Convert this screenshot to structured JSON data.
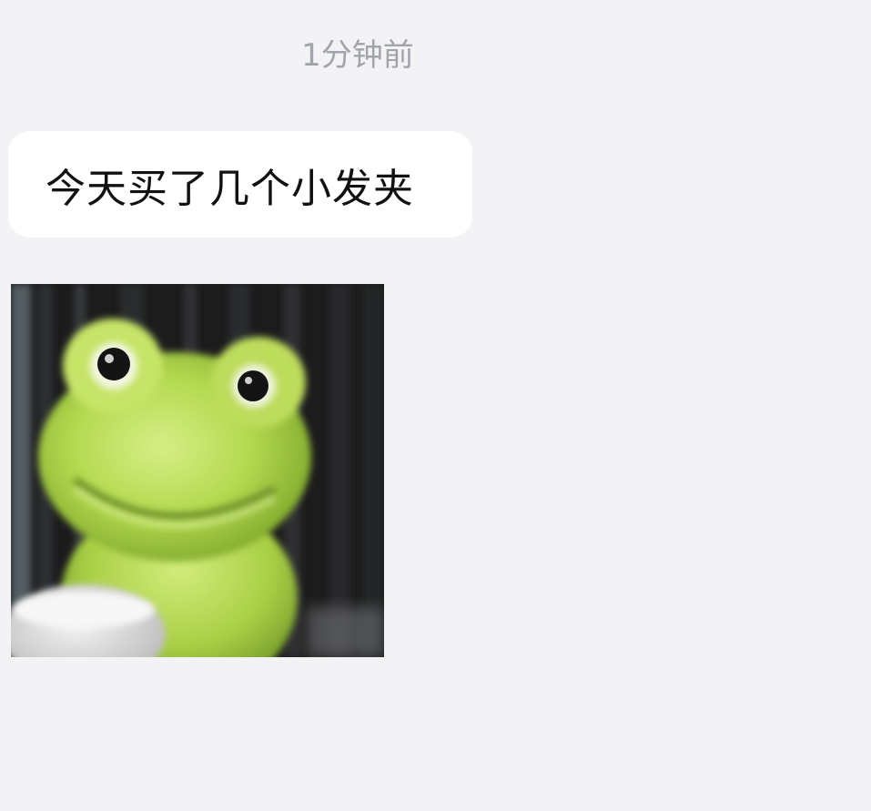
{
  "conversation": {
    "timestamp": "1分钟前",
    "messages": [
      {
        "type": "text",
        "text": "今天买了几个小发夹"
      },
      {
        "type": "image",
        "content": "sticker-frog-photo"
      }
    ]
  },
  "colors": {
    "background": "#f3f3f5",
    "bubble": "#ffffff",
    "timestamp": "#a1a4ab",
    "text": "#111111",
    "frog": "#a8d24a"
  }
}
